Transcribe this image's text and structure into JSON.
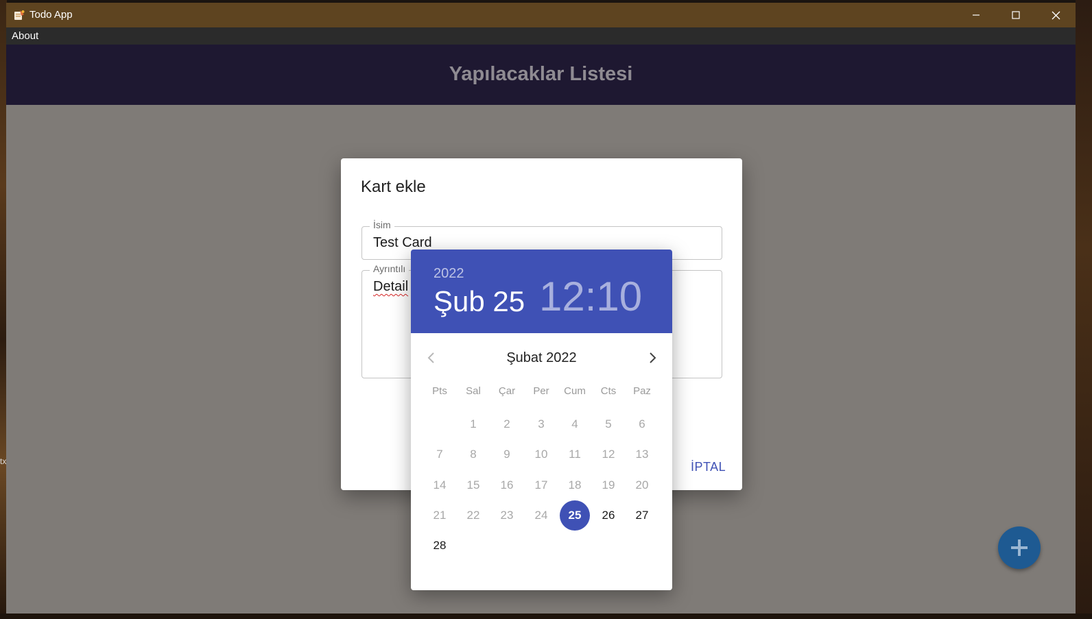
{
  "window": {
    "title": "Todo App",
    "icon": "todo-app-icon",
    "controls": [
      "minimize-icon",
      "maximize-icon",
      "close-icon"
    ]
  },
  "menu": {
    "about": "About"
  },
  "appbar": {
    "title": "Yapılacaklar Listesi"
  },
  "fab": {
    "icon": "plus-icon",
    "color": "#1e5a92"
  },
  "desktop": {
    "fragment": "tx"
  },
  "dialog": {
    "title": "Kart ekle",
    "name_label": "İsim",
    "name_value": "Test Card",
    "details_label": "Ayrıntılı",
    "details_value": "Detail",
    "cancel_label": "İPTAL"
  },
  "picker": {
    "accent": "#3f51b5",
    "year": "2022",
    "date": "Şub 25",
    "hour": "12",
    "separator": ":",
    "minute": "10",
    "month_title": "Şubat 2022",
    "weekdays": [
      "Pts",
      "Sal",
      "Çar",
      "Per",
      "Cum",
      "Cts",
      "Paz"
    ],
    "days": [
      "1",
      "2",
      "3",
      "4",
      "5",
      "6",
      "7",
      "8",
      "9",
      "10",
      "11",
      "12",
      "13",
      "14",
      "15",
      "16",
      "17",
      "18",
      "19",
      "20",
      "21",
      "22",
      "23",
      "24",
      "25",
      "26",
      "27",
      "28"
    ],
    "selected_day": "25"
  }
}
